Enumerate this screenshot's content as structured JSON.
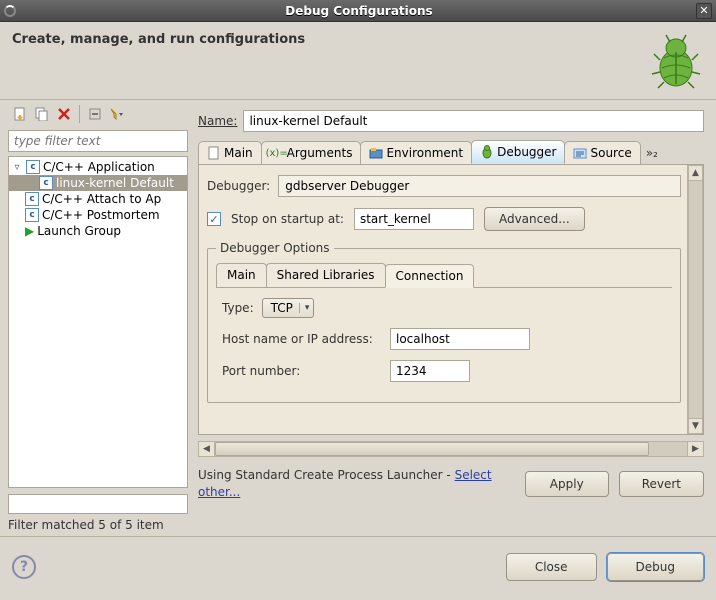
{
  "window": {
    "title": "Debug Configurations"
  },
  "header": {
    "title": "Create, manage, and run configurations"
  },
  "left": {
    "filter_placeholder": "type filter text",
    "tree": {
      "root_label": "C/C++ Application",
      "items": [
        "linux-kernel Default",
        "C/C++ Attach to Ap",
        "C/C++ Postmortem",
        "Launch Group"
      ]
    },
    "filter_status": "Filter matched 5 of 5 item"
  },
  "form": {
    "name_label": "Name:",
    "name_value": "linux-kernel Default",
    "tabs": [
      "Main",
      "Arguments",
      "Environment",
      "Debugger",
      "Source"
    ],
    "more_indicator": "»₂",
    "debugger_label": "Debugger:",
    "debugger_value": "gdbserver Debugger",
    "stop_checkbox_label": "Stop on startup at:",
    "stop_value": "start_kernel",
    "advanced_label": "Advanced...",
    "options_legend": "Debugger Options",
    "subtabs": [
      "Main",
      "Shared Libraries",
      "Connection"
    ],
    "type_label": "Type:",
    "type_value": "TCP",
    "host_label": "Host name or IP address:",
    "host_value": "localhost",
    "port_label": "Port number:",
    "port_value": "1234",
    "launcher_text": "Using Standard Create Process Launcher - ",
    "launcher_link": "Select other...",
    "apply_label": "Apply",
    "revert_label": "Revert"
  },
  "footer": {
    "close_label": "Close",
    "debug_label": "Debug"
  }
}
